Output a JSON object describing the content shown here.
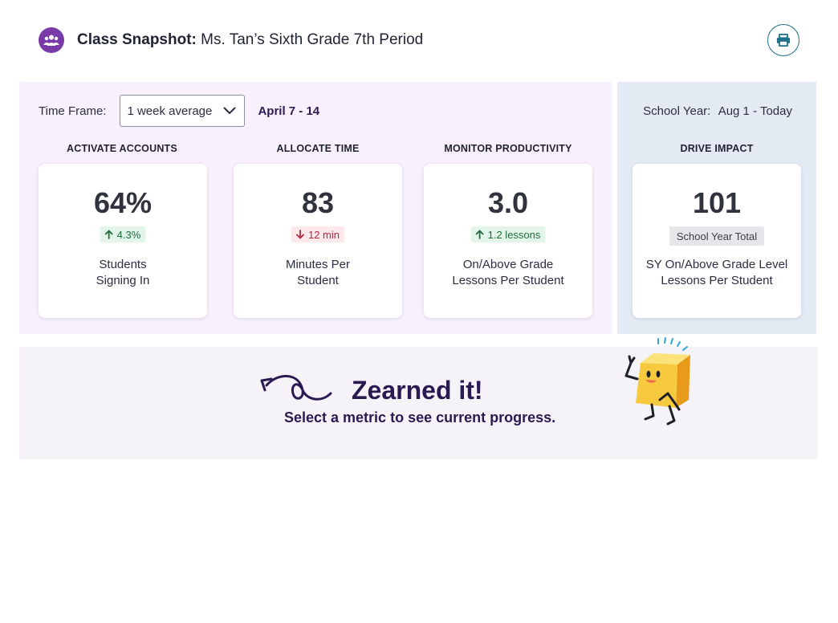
{
  "header": {
    "title_bold": "Class Snapshot:",
    "title_rest": "Ms. Tan’s Sixth Grade 7th Period",
    "class_icon": "group-icon",
    "print_icon": "printer-icon"
  },
  "timeframe": {
    "label": "Time Frame:",
    "selected": "1 week average",
    "range": "April 7 - 14"
  },
  "school_year": {
    "label": "School Year:",
    "range": "Aug 1 - Today"
  },
  "sections": [
    {
      "heading": "ACTIVATE ACCOUNTS",
      "value": "64%",
      "delta": "4.3%",
      "delta_direction": "up",
      "label_line1": "Students",
      "label_line2": "Signing In"
    },
    {
      "heading": "ALLOCATE TIME",
      "value": "83",
      "delta": "12 min",
      "delta_direction": "down",
      "label_line1": "Minutes Per",
      "label_line2": "Student"
    },
    {
      "heading": "MONITOR PRODUCTIVITY",
      "value": "3.0",
      "delta": "1.2 lessons",
      "delta_direction": "up",
      "label_line1": "On/Above Grade",
      "label_line2": "Lessons Per Student"
    },
    {
      "heading": "DRIVE IMPACT",
      "value": "101",
      "delta": "School Year Total",
      "delta_direction": "neutral",
      "label_line1": "SY On/Above Grade Level",
      "label_line2": "Lessons Per Student"
    }
  ],
  "banner": {
    "title": "Zearned it!",
    "subtitle": "Select a metric to see current progress."
  },
  "colors": {
    "brand_purple": "#7a3aa8",
    "weekly_bg": "#f8f0fd",
    "year_bg": "#e3eaf4",
    "up_green": "#1e6b3c",
    "down_red": "#b3263d",
    "mascot_yellow": "#f7c93e"
  }
}
